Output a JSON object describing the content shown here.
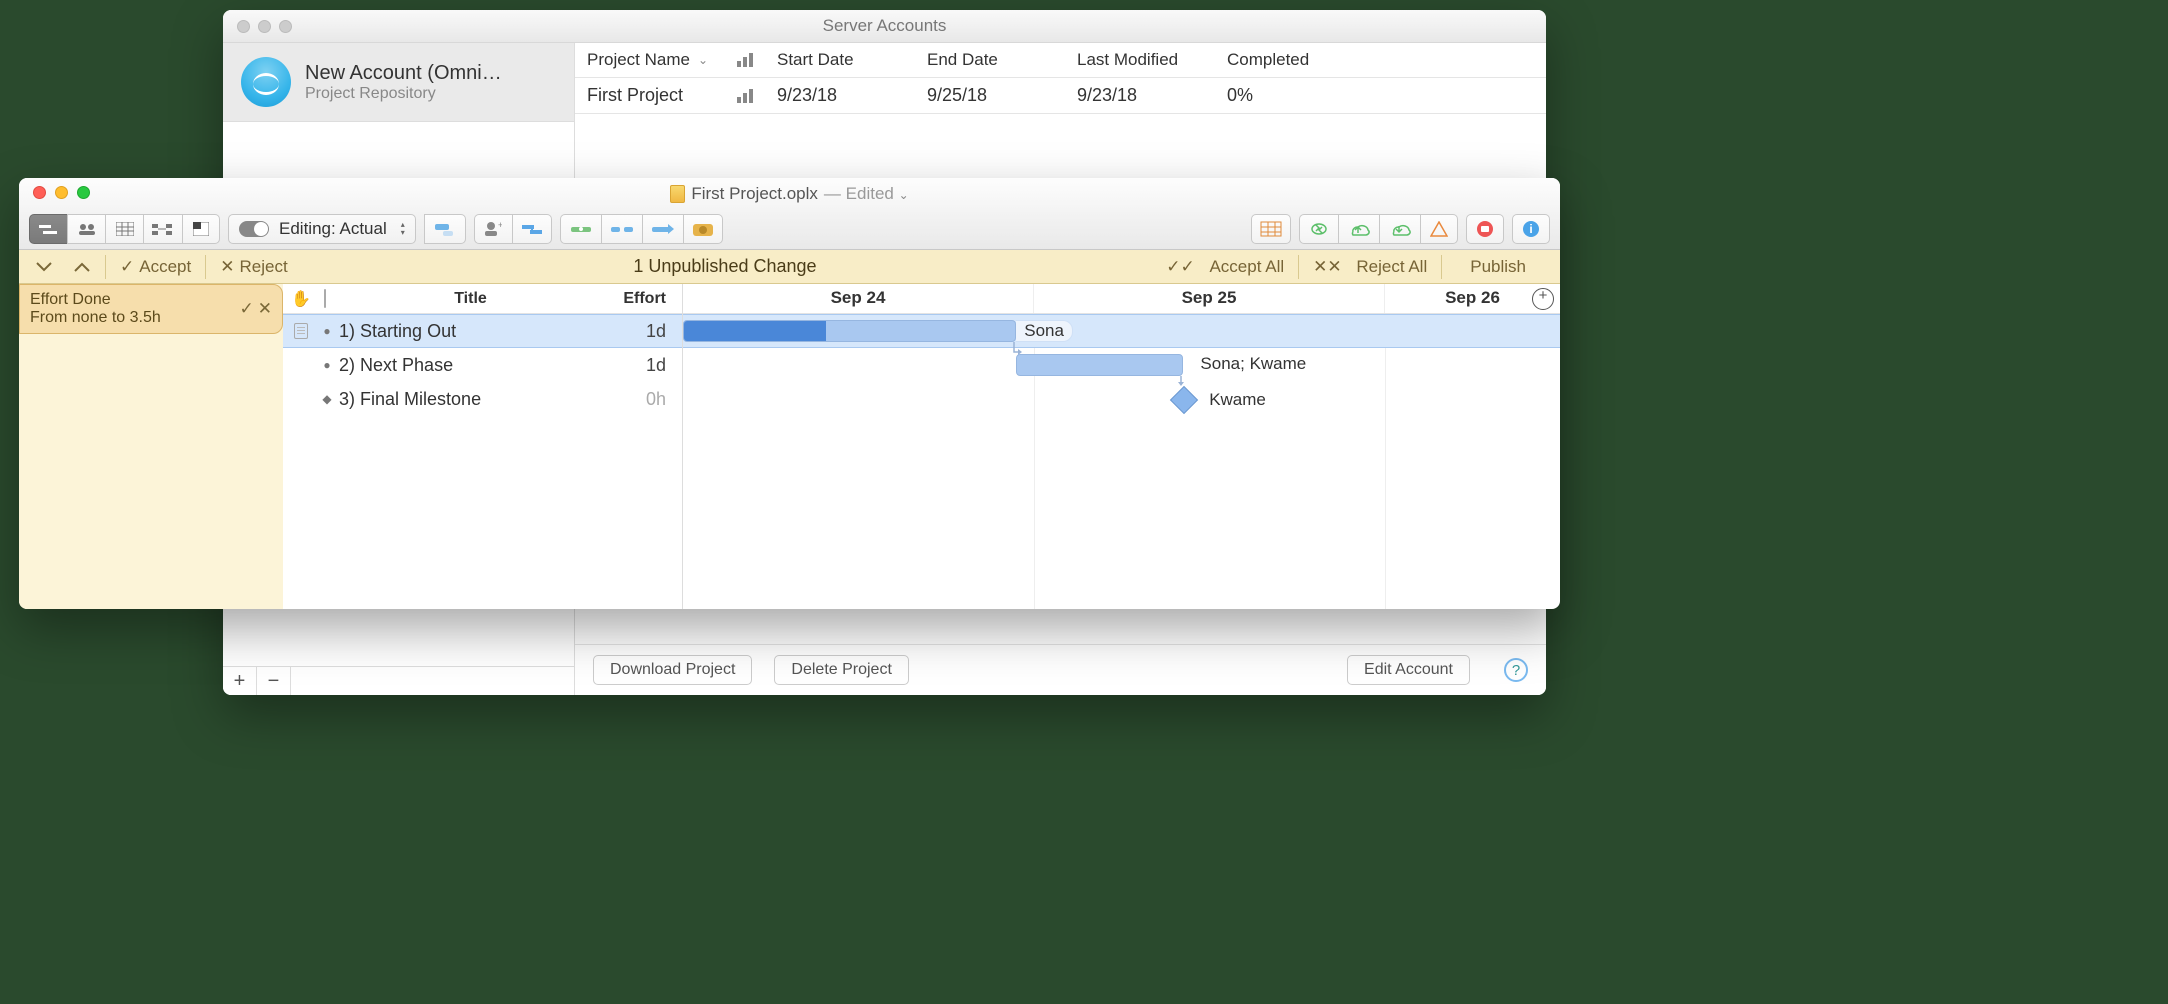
{
  "back": {
    "title": "Server Accounts",
    "account": {
      "name": "New Account (Omni…",
      "subtitle": "Project Repository"
    },
    "columns": {
      "name": "Project Name",
      "start": "Start Date",
      "end": "End Date",
      "mod": "Last Modified",
      "comp": "Completed"
    },
    "row": {
      "name": "First Project",
      "start": "9/23/18",
      "end": "9/25/18",
      "mod": "9/23/18",
      "comp": "0%"
    },
    "buttons": {
      "download": "Download Project",
      "delete": "Delete Project",
      "edit": "Edit Account"
    }
  },
  "front": {
    "doc_title": "First Project.oplx",
    "edited": "— Edited",
    "editing_label": "Editing: Actual",
    "changebar": {
      "accept": "Accept",
      "reject": "Reject",
      "msg": "1 Unpublished Change",
      "accept_all": "Accept All",
      "reject_all": "Reject All",
      "publish": "Publish"
    },
    "change_card": {
      "line1": "Effort Done",
      "line2": "From none to 3.5h"
    },
    "outline": {
      "headers": {
        "title": "Title",
        "effort": "Effort"
      },
      "rows": [
        {
          "num": "1)",
          "title": "Starting Out",
          "effort": "1d",
          "sel": true,
          "kind": "task"
        },
        {
          "num": "2)",
          "title": "Next Phase",
          "effort": "1d",
          "sel": false,
          "kind": "task"
        },
        {
          "num": "3)",
          "title": "Final Milestone",
          "effort": "0h",
          "sel": false,
          "kind": "milestone"
        }
      ]
    },
    "gantt": {
      "days": [
        "Sep 24",
        "Sep 25",
        "Sep 26"
      ],
      "task1_label": "Sona",
      "task2_label": "Sona; Kwame",
      "task3_label": "Kwame"
    }
  }
}
